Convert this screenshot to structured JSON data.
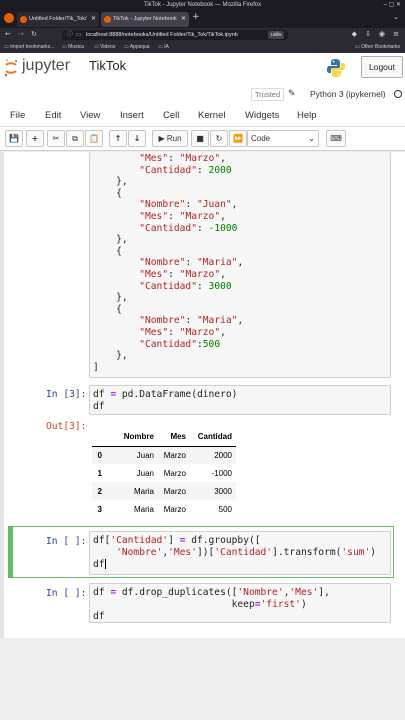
{
  "browser": {
    "window_title": "TikTok - Jupyter Notebook — Mozilla Firefox",
    "tabs": [
      {
        "label": "Untitled Folder/Tik_Tok/"
      },
      {
        "label": "TikTok - Jupyter Notebook"
      }
    ],
    "url": "localhost:8888/notebooks/Untitled Folder/Tik_Tok/TikTok.ipynb",
    "zoom": "160%",
    "bookmarks": [
      "Import bookmarks...",
      "Musica",
      "Videos",
      "Appsqua",
      "IA"
    ],
    "other_bookmarks": "Other Bookmarks"
  },
  "jupyter": {
    "logo_text": "jupyter",
    "notebook_name": "TikTok",
    "logout_label": "Logout",
    "trusted_label": "Trusted",
    "kernel_label": "Python 3 (ipykernel)"
  },
  "menu": [
    "File",
    "Edit",
    "View",
    "Insert",
    "Cell",
    "Kernel",
    "Widgets",
    "Help"
  ],
  "toolbar": {
    "run_label": "Run",
    "cell_type": "Code"
  },
  "cells": {
    "dict_tail": [
      "        \"Mes\": \"Marzo\",",
      "        \"Cantidad\": 2000",
      "    },",
      "    {",
      "        \"Nombre\": \"Juan\",",
      "        \"Mes\": \"Marzo\",",
      "        \"Cantidad\": -1000",
      "    },",
      "    {",
      "        \"Nombre\": \"Maria\",",
      "        \"Mes\": \"Marzo\",",
      "        \"Cantidad\": 3000",
      "    },",
      "    {",
      "        \"Nombre\": \"Maria\",",
      "        \"Mes\": \"Marzo\",",
      "        \"Cantidad\":500",
      "    },",
      "]"
    ],
    "cell3": {
      "in_prompt": "In [3]:",
      "out_prompt": "Out[3]:",
      "code_line1": "df = pd.DataFrame(dinero)",
      "code_line2": "df"
    },
    "dataframe": {
      "columns": [
        "Nombre",
        "Mes",
        "Cantidad"
      ],
      "rows": [
        {
          "index": "0",
          "Nombre": "Juan",
          "Mes": "Marzo",
          "Cantidad": "2000"
        },
        {
          "index": "1",
          "Nombre": "Juan",
          "Mes": "Marzo",
          "Cantidad": "-1000"
        },
        {
          "index": "2",
          "Nombre": "Maria",
          "Mes": "Marzo",
          "Cantidad": "3000"
        },
        {
          "index": "3",
          "Nombre": "Maria",
          "Mes": "Marzo",
          "Cantidad": "500"
        }
      ]
    },
    "cell4": {
      "in_prompt": "In [ ]:",
      "code_line1": "df['Cantidad'] = df.groupby([",
      "code_line2": "    'Nombre','Mes'])['Cantidad'].transform('sum')",
      "code_line3": "df"
    },
    "cell5": {
      "in_prompt": "In [ ]:",
      "code_line1": "df = df.drop_duplicates(['Nombre','Mes'],",
      "code_line2": "                        keep='first')",
      "code_line3": "df"
    }
  },
  "colors": {
    "string": "#ba2121",
    "number": "#008000",
    "prompt_in": "#303f9f",
    "prompt_out": "#d84315",
    "selected_cell": "#66bb6a"
  }
}
